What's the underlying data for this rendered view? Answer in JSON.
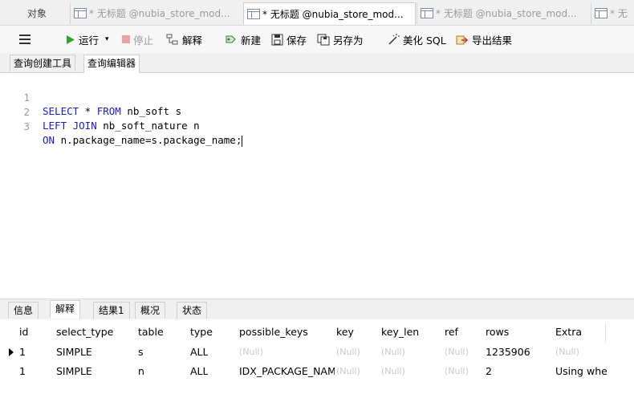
{
  "tabs": {
    "objects_label": "对象",
    "items": [
      {
        "label": "* 无标题 @nubia_store_mod..."
      },
      {
        "label": "* 无标题 @nubia_store_mod..."
      },
      {
        "label": "* 无标题 @nubia_store_mod..."
      },
      {
        "label": "* 无"
      }
    ]
  },
  "toolbar": {
    "run_label": "运行",
    "stop_label": "停止",
    "explain_label": "解释",
    "new_label": "新建",
    "save_label": "保存",
    "save_as_label": "另存为",
    "beautify_label": "美化 SQL",
    "export_label": "导出结果"
  },
  "subtabs": {
    "builder_label": "查询创建工具",
    "editor_label": "查询编辑器"
  },
  "editor": {
    "lines": [
      {
        "num": "1",
        "keyword": "SELECT",
        "rest": " * ",
        "keyword2": "FROM",
        "rest2": " nb_soft s"
      },
      {
        "num": "2",
        "keyword": "LEFT JOIN",
        "rest": " nb_soft_nature n",
        "keyword2": "",
        "rest2": ""
      },
      {
        "num": "3",
        "keyword": "ON",
        "rest": " n.package_name=s.package_name;",
        "keyword2": "",
        "rest2": ""
      }
    ]
  },
  "bottom_tabs": {
    "info_label": "信息",
    "explain_label": "解释",
    "result_label": "结果1",
    "overview_label": "概况",
    "status_label": "状态"
  },
  "grid": {
    "columns": [
      "id",
      "select_type",
      "table",
      "type",
      "possible_keys",
      "key",
      "key_len",
      "ref",
      "rows",
      "Extra"
    ],
    "rows": [
      {
        "id": "1",
        "select_type": "SIMPLE",
        "table": "s",
        "type": "ALL",
        "possible_keys": "(Null)",
        "key": "(Null)",
        "key_len": "(Null)",
        "ref": "(Null)",
        "rows": "1235906",
        "extra": "(Null)"
      },
      {
        "id": "1",
        "select_type": "SIMPLE",
        "table": "n",
        "type": "ALL",
        "possible_keys": "IDX_PACKAGE_NAME",
        "key": "(Null)",
        "key_len": "(Null)",
        "ref": "(Null)",
        "rows": "2",
        "extra": "Using whe"
      }
    ]
  },
  "colors": {
    "keyword": "#1a1ad6",
    "run_green": "#2ea62e",
    "null_text": "#c8c8c8"
  }
}
